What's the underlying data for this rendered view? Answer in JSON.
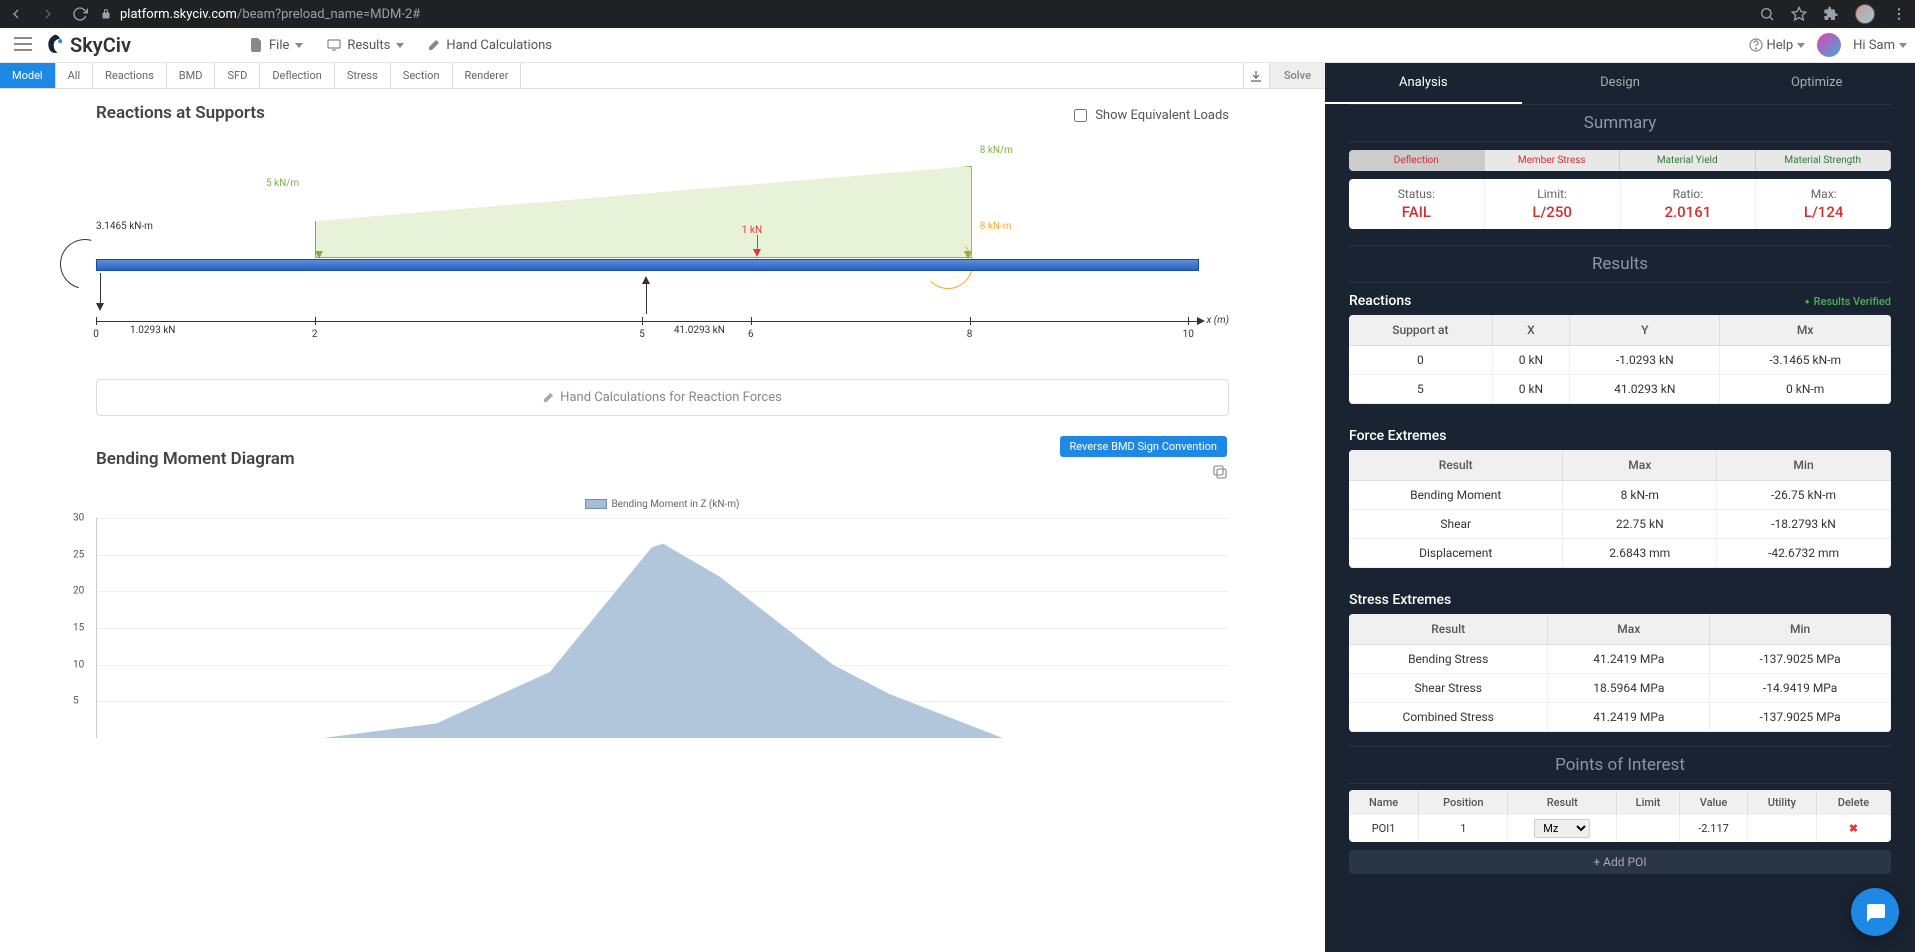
{
  "browser": {
    "url_domain": "platform.skyciv.com",
    "url_path": "/beam?preload_name=MDM-2#"
  },
  "header": {
    "logo_text": "SkyCiv",
    "menus": {
      "file": "File",
      "results": "Results",
      "hand_calc": "Hand Calculations"
    },
    "help": "Help",
    "user": "Hi Sam"
  },
  "tabs": [
    "Model",
    "All",
    "Reactions",
    "BMD",
    "SFD",
    "Deflection",
    "Stress",
    "Section",
    "Renderer"
  ],
  "solve": "Solve",
  "reactions": {
    "title": "Reactions at Supports",
    "show_equiv": "Show Equivalent Loads",
    "hand_calc_btn": "Hand Calculations for Reaction Forces",
    "axis_unit": "x (m)",
    "axis_ticks": [
      "0",
      "2",
      "5",
      "6",
      "8",
      "10"
    ],
    "labels": {
      "moment_left": "3.1465 kN-m",
      "dist_left": "5 kN/m",
      "dist_right": "8 kN/m",
      "point": "1 kN",
      "moment_right": "8 kN-m",
      "r_left": "1.0293 kN",
      "r_right": "41.0293 kN"
    }
  },
  "bmd": {
    "title": "Bending Moment Diagram",
    "reverse": "Reverse BMD Sign Convention",
    "legend": "Bending Moment in Z (kN-m)"
  },
  "chart_data": {
    "type": "area",
    "title": "Bending Moment in Z (kN-m)",
    "ylabel": "kN-m",
    "ylim": [
      0,
      30
    ],
    "yticks": [
      5,
      10,
      15,
      20,
      25,
      30
    ],
    "x": [
      0,
      1,
      2,
      3,
      4,
      4.9,
      5,
      5.5,
      6,
      6.5,
      7,
      7.5,
      8,
      8.5,
      9,
      9.5,
      10
    ],
    "values": [
      0,
      0,
      0,
      2,
      9,
      26,
      26.5,
      22,
      16,
      10,
      6,
      3,
      0,
      0,
      0,
      0,
      0
    ]
  },
  "right": {
    "tabs": [
      "Analysis",
      "Design",
      "Optimize"
    ],
    "summary_heading": "Summary",
    "summary_tabs": [
      "Deflection",
      "Member Stress",
      "Material Yield",
      "Material Strength"
    ],
    "summary_cols": [
      {
        "label": "Status:",
        "value": "FAIL"
      },
      {
        "label": "Limit:",
        "value": "L/250"
      },
      {
        "label": "Ratio:",
        "value": "2.0161"
      },
      {
        "label": "Max:",
        "value": "L/124"
      }
    ],
    "results_heading": "Results",
    "reactions_label": "Reactions",
    "verified": "Results Verified",
    "reactions_table": {
      "headers": [
        "Support at",
        "X",
        "Y",
        "Mx"
      ],
      "rows": [
        [
          "0",
          "0 kN",
          "-1.0293 kN",
          "-3.1465 kN-m"
        ],
        [
          "5",
          "0 kN",
          "41.0293 kN",
          "0 kN-m"
        ]
      ]
    },
    "force_label": "Force Extremes",
    "force_table": {
      "headers": [
        "Result",
        "Max",
        "Min"
      ],
      "rows": [
        [
          "Bending Moment",
          "8 kN-m",
          "-26.75 kN-m"
        ],
        [
          "Shear",
          "22.75 kN",
          "-18.2793 kN"
        ],
        [
          "Displacement",
          "2.6843 mm",
          "-42.6732 mm"
        ]
      ]
    },
    "stress_label": "Stress Extremes",
    "stress_table": {
      "headers": [
        "Result",
        "Max",
        "Min"
      ],
      "rows": [
        [
          "Bending Stress",
          "41.2419 MPa",
          "-137.9025 MPa"
        ],
        [
          "Shear Stress",
          "18.5964 MPa",
          "-14.9419 MPa"
        ],
        [
          "Combined Stress",
          "41.2419 MPa",
          "-137.9025 MPa"
        ]
      ]
    },
    "poi_heading": "Points of Interest",
    "poi_table": {
      "headers": [
        "Name",
        "Position",
        "Result",
        "Limit",
        "Value",
        "Utility",
        "Delete"
      ],
      "row": {
        "name": "POI1",
        "position": "1",
        "result": "Mz",
        "limit": "",
        "value": "-2.117",
        "utility": ""
      }
    },
    "add_poi": "+  Add POI"
  }
}
